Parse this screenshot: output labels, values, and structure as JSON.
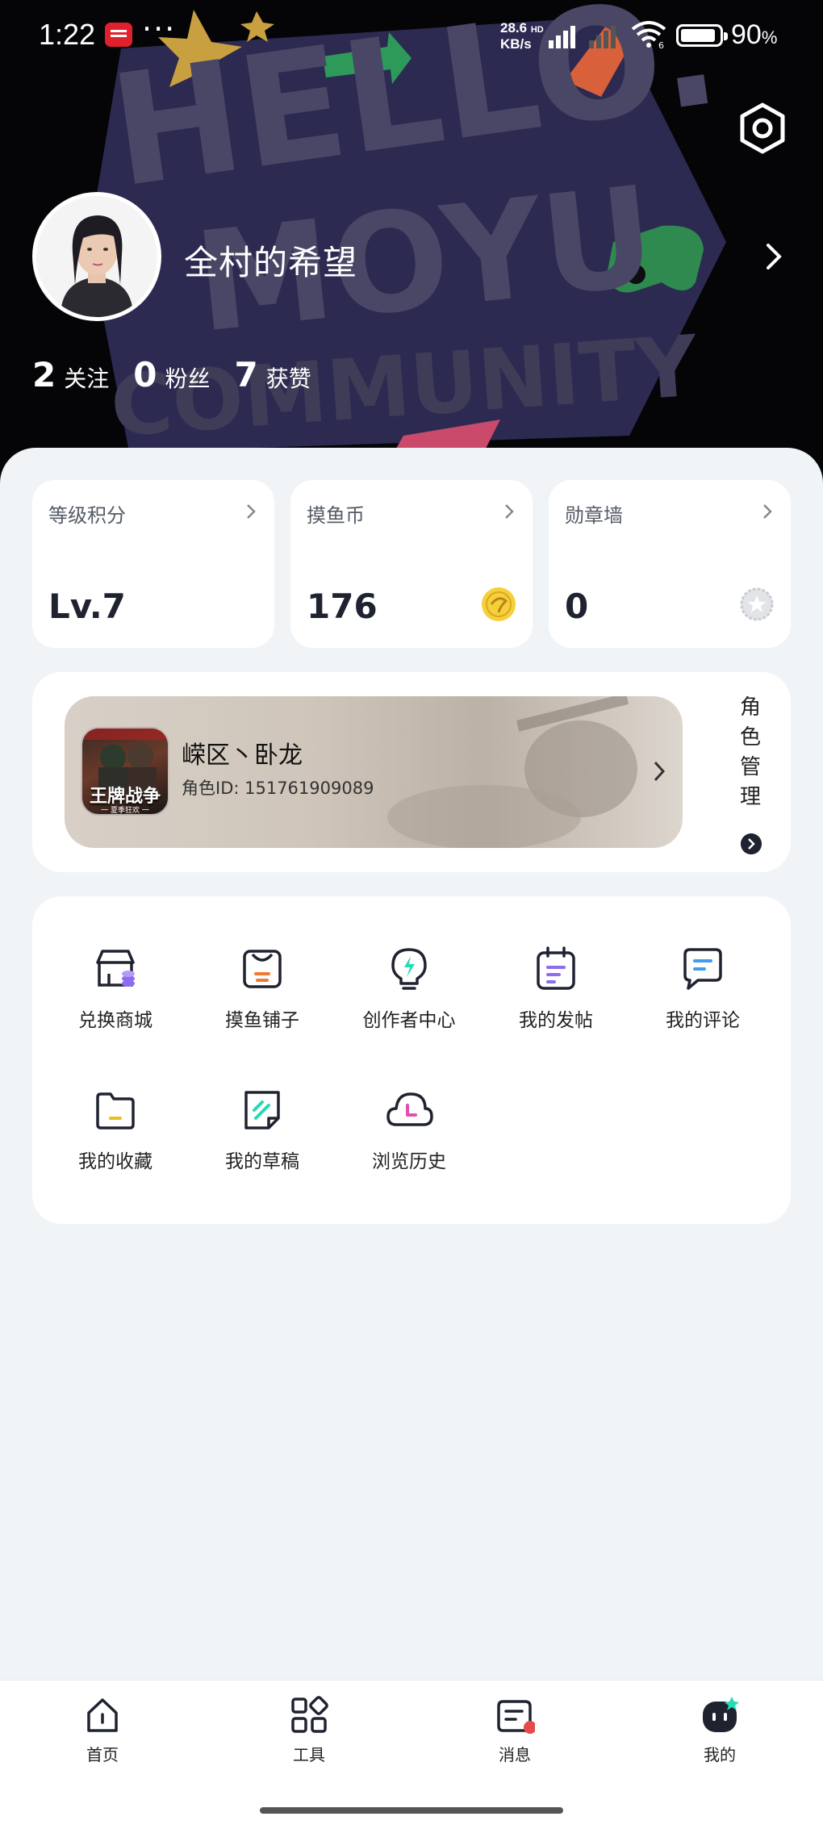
{
  "status_bar": {
    "time": "1:22",
    "net_speed_value": "28.6",
    "net_speed_unit": "KB/s",
    "net_hd": "HD",
    "wifi_label": "6",
    "battery_pct": "90",
    "battery_unit": "%"
  },
  "profile": {
    "header_art_text": [
      "HELLO.",
      "MOYU",
      "COMMUNITY"
    ],
    "username": "全村的希望",
    "stats": [
      {
        "value": "2",
        "label": "关注"
      },
      {
        "value": "0",
        "label": "粉丝"
      },
      {
        "value": "7",
        "label": "获赞"
      }
    ]
  },
  "cards": [
    {
      "title": "等级积分",
      "value": "Lv.7",
      "icon": "none"
    },
    {
      "title": "摸鱼币",
      "value": "176",
      "icon": "coin-icon"
    },
    {
      "title": "勋章墙",
      "value": "0",
      "icon": "medal-icon"
    }
  ],
  "role": {
    "game_name": "王牌战争",
    "game_subtitle": "一 夏季狂欢 一",
    "name": "嵘区丶卧龙",
    "id_label": "角色ID: 151761909089",
    "manage_chars": [
      "角",
      "色",
      "管",
      "理"
    ]
  },
  "tools": [
    {
      "label": "兑换商城",
      "icon": "store-icon"
    },
    {
      "label": "摸鱼铺子",
      "icon": "shop-bag-icon"
    },
    {
      "label": "创作者中心",
      "icon": "lightbulb-icon"
    },
    {
      "label": "我的发帖",
      "icon": "notepad-icon"
    },
    {
      "label": "我的评论",
      "icon": "comment-icon"
    },
    {
      "label": "我的收藏",
      "icon": "folder-icon"
    },
    {
      "label": "我的草稿",
      "icon": "draft-icon"
    },
    {
      "label": "浏览历史",
      "icon": "history-cloud-icon"
    }
  ],
  "tabbar": [
    {
      "label": "首页",
      "icon": "home-icon"
    },
    {
      "label": "工具",
      "icon": "grid-icon"
    },
    {
      "label": "消息",
      "icon": "message-icon"
    },
    {
      "label": "我的",
      "icon": "profile-mascot-icon"
    }
  ],
  "colors": {
    "header_bg": "#050507",
    "art_purple": "#3d3a55",
    "page_bg": "#f1f4f7",
    "accent_teal": "#27d9b5",
    "badge_red": "#e64a4a",
    "coin_yellow": "#f6cf3c"
  }
}
